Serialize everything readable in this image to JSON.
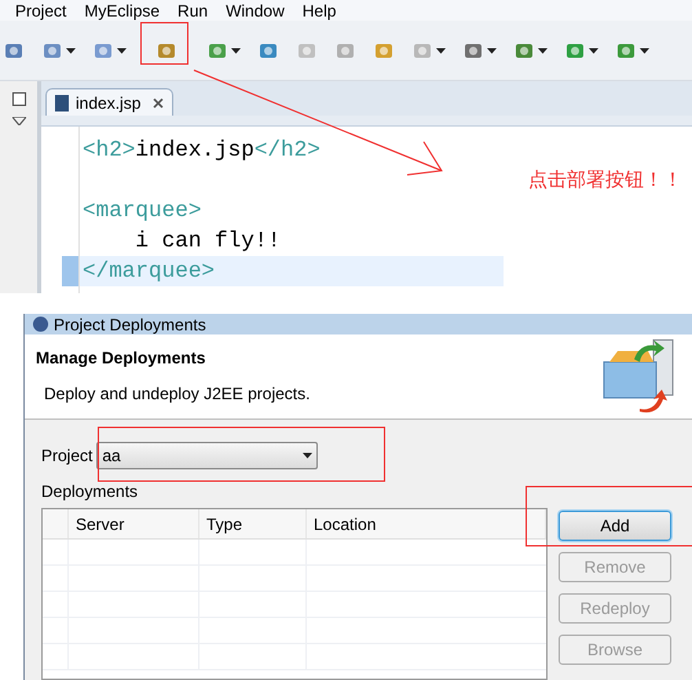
{
  "menu": [
    "Project",
    "MyEclipse",
    "Run",
    "Window",
    "Help"
  ],
  "editor": {
    "tab": "index.jsp",
    "lines": [
      {
        "kind": "code",
        "current": false,
        "segments": [
          {
            "kind": "tag",
            "text": "<h2>"
          },
          {
            "kind": "text",
            "text": "index.jsp"
          },
          {
            "kind": "tag",
            "text": "</h2>"
          }
        ]
      },
      {
        "kind": "blank"
      },
      {
        "kind": "code",
        "current": false,
        "segments": [
          {
            "kind": "tag",
            "text": "<marquee>"
          }
        ]
      },
      {
        "kind": "code",
        "current": false,
        "segments": [
          {
            "kind": "text",
            "text": "    i can fly!!"
          }
        ]
      },
      {
        "kind": "code",
        "current": true,
        "segments": [
          {
            "kind": "tag",
            "text": "</marquee>"
          }
        ]
      }
    ]
  },
  "annotation": {
    "text": "点击部署按钮！！"
  },
  "dialog": {
    "title": "Project Deployments",
    "heading": "Manage Deployments",
    "description": "Deploy and undeploy J2EE projects.",
    "project_label": "Project",
    "project_value": "aa",
    "deployments_label": "Deployments",
    "columns": [
      "Server",
      "Type",
      "Location"
    ],
    "buttons": [
      {
        "label": "Add",
        "disabled": false,
        "focused": true
      },
      {
        "label": "Remove",
        "disabled": true,
        "focused": false
      },
      {
        "label": "Redeploy",
        "disabled": true,
        "focused": false
      },
      {
        "label": "Browse",
        "disabled": true,
        "focused": false
      }
    ]
  }
}
